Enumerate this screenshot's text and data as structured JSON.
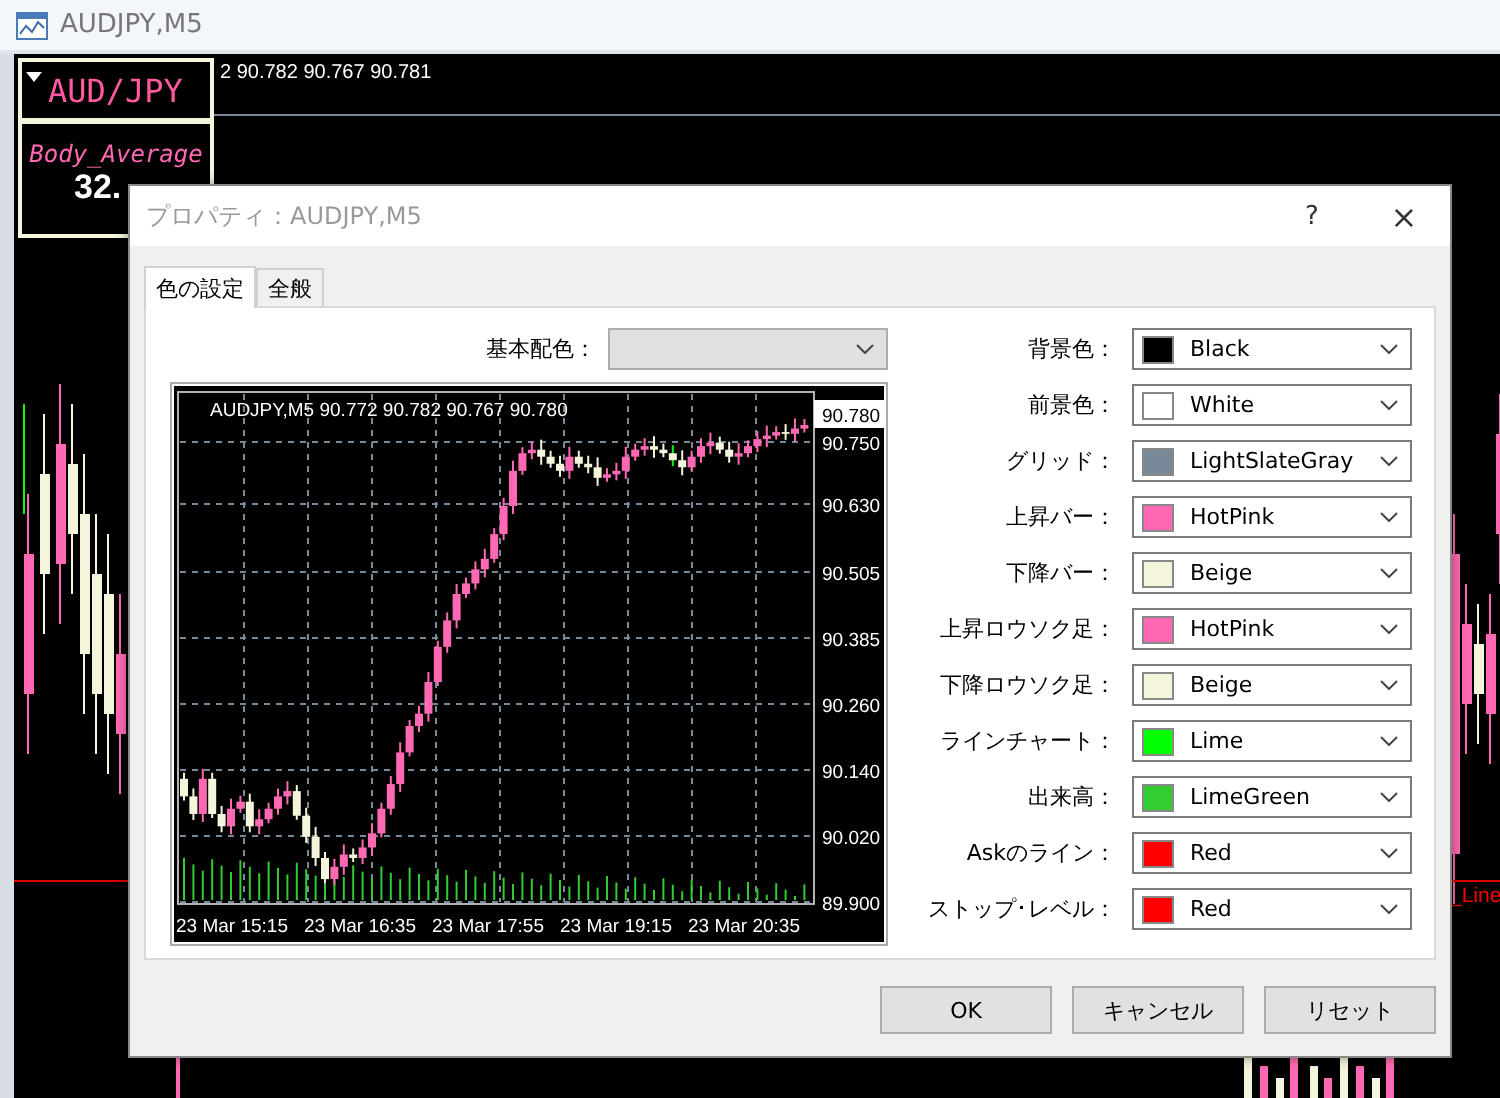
{
  "window": {
    "title": "AUDJPY,M5"
  },
  "background_chart": {
    "price_readout": "2 90.782 90.767 90.781",
    "symbol_label": "AUD/JPY",
    "indicator_name": "Body_Average",
    "indicator_value": "32.",
    "line_label": "_Line"
  },
  "dialog": {
    "title": "プロパティ：AUDJPY,M5",
    "help": "?",
    "close": "×",
    "tabs": [
      {
        "label": "色の設定",
        "selected": true
      },
      {
        "label": "全般",
        "selected": false
      }
    ],
    "scheme": {
      "label": "基本配色：",
      "disabled": true
    },
    "preview": {
      "header": "AUDJPY,M5  90.772 90.782 90.767 90.780",
      "price_labels": [
        {
          "label": "90.780",
          "current": true
        },
        {
          "label": "90.750",
          "current": false
        },
        {
          "label": "90.630",
          "current": false
        },
        {
          "label": "90.505",
          "current": false
        },
        {
          "label": "90.385",
          "current": false
        },
        {
          "label": "90.260",
          "current": false
        },
        {
          "label": "90.140",
          "current": false
        },
        {
          "label": "90.020",
          "current": false
        },
        {
          "label": "89.900",
          "current": false
        }
      ],
      "time_labels": [
        "23 Mar 15:15",
        "23 Mar 16:35",
        "23 Mar 17:55",
        "23 Mar 19:15",
        "23 Mar 20:35"
      ]
    },
    "colors": [
      {
        "label": "背景色：",
        "value": "Black",
        "color": "#000000"
      },
      {
        "label": "前景色：",
        "value": "White",
        "color": "#ffffff"
      },
      {
        "label": "グリッド：",
        "value": "LightSlateGray",
        "color": "#778899"
      },
      {
        "label": "上昇バー：",
        "value": "HotPink",
        "color": "#ff69b4"
      },
      {
        "label": "下降バー：",
        "value": "Beige",
        "color": "#f5f5dc"
      },
      {
        "label": "上昇ロウソク足：",
        "value": "HotPink",
        "color": "#ff69b4"
      },
      {
        "label": "下降ロウソク足：",
        "value": "Beige",
        "color": "#f5f5dc"
      },
      {
        "label": "ラインチャート：",
        "value": "Lime",
        "color": "#00ff00"
      },
      {
        "label": "出来高：",
        "value": "LimeGreen",
        "color": "#32cd32"
      },
      {
        "label": "Askのライン：",
        "value": "Red",
        "color": "#ff0000"
      },
      {
        "label": "ストップ･レベル：",
        "value": "Red",
        "color": "#ff0000"
      }
    ],
    "buttons": [
      "OK",
      "キャンセル",
      "リセット"
    ]
  }
}
